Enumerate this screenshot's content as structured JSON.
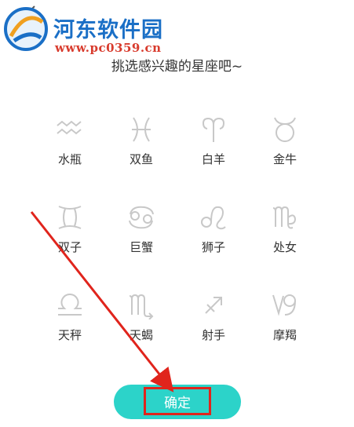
{
  "watermark": {
    "title": "河东软件园",
    "url": "www.pc0359.cn"
  },
  "subtitle": "挑选感兴趣的星座吧~",
  "signs": [
    {
      "label": "水瓶",
      "icon": "aquarius-icon"
    },
    {
      "label": "双鱼",
      "icon": "pisces-icon"
    },
    {
      "label": "白羊",
      "icon": "aries-icon"
    },
    {
      "label": "金牛",
      "icon": "taurus-icon"
    },
    {
      "label": "双子",
      "icon": "gemini-icon"
    },
    {
      "label": "巨蟹",
      "icon": "cancer-icon"
    },
    {
      "label": "狮子",
      "icon": "leo-icon"
    },
    {
      "label": "处女",
      "icon": "virgo-icon"
    },
    {
      "label": "天秤",
      "icon": "libra-icon"
    },
    {
      "label": "天蝎",
      "icon": "scorpio-icon"
    },
    {
      "label": "射手",
      "icon": "sagittarius-icon"
    },
    {
      "label": "摩羯",
      "icon": "capricorn-icon"
    }
  ],
  "confirm_label": "确定",
  "colors": {
    "accent": "#2cd3c9",
    "icon_gray": "#c8c8c8",
    "annotation_red": "#e0241c"
  }
}
